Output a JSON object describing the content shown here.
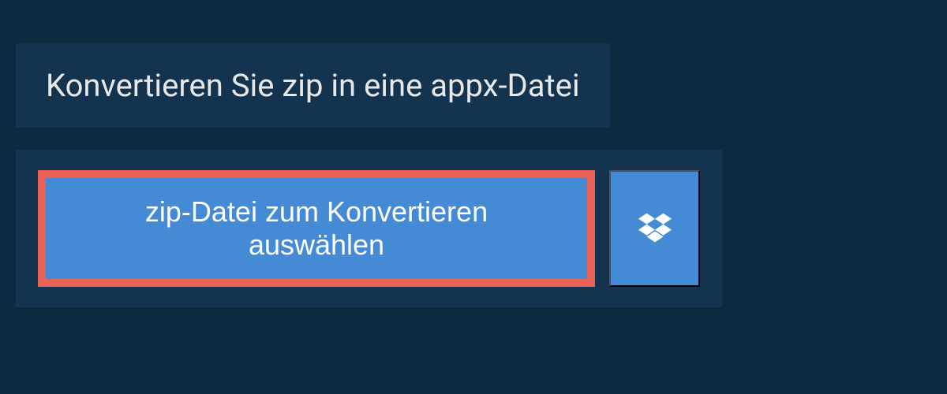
{
  "header": {
    "title": "Konvertieren Sie zip in eine appx-Datei"
  },
  "actions": {
    "select_file_label": "zip-Datei zum Konvertieren auswählen"
  }
}
